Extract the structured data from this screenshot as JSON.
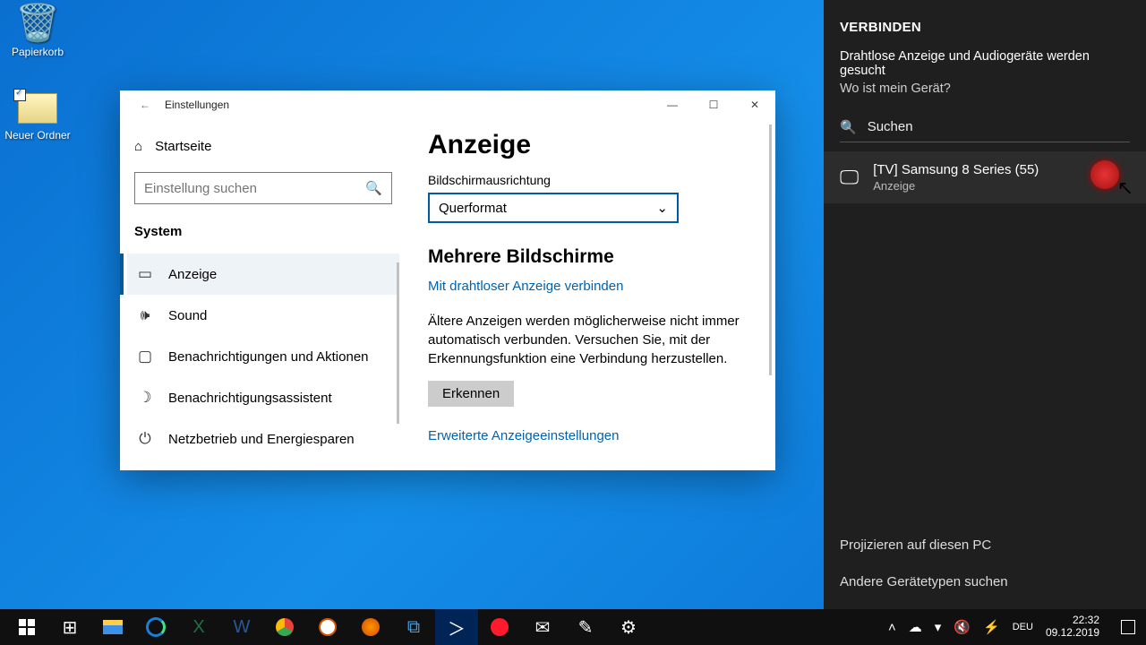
{
  "desktop": {
    "recycle_bin": "Papierkorb",
    "new_folder": "Neuer Ordner"
  },
  "window": {
    "title": "Einstellungen",
    "home": "Startseite",
    "search_placeholder": "Einstellung suchen",
    "category": "System",
    "nav": [
      {
        "icon": "display-icon",
        "glyph": "▭",
        "label": "Anzeige",
        "active": true
      },
      {
        "icon": "speaker-icon",
        "glyph": "🔊",
        "label": "Sound"
      },
      {
        "icon": "bell-icon",
        "glyph": "▢",
        "label": "Benachrichtigungen und Aktionen"
      },
      {
        "icon": "moon-icon",
        "glyph": "☽",
        "label": "Benachrichtigungsassistent"
      },
      {
        "icon": "power-icon",
        "glyph": "⏻",
        "label": "Netzbetrieb und Energiesparen"
      }
    ],
    "content": {
      "page_title": "Anzeige",
      "orientation_label": "Bildschirmausrichtung",
      "orientation_value": "Querformat",
      "multi_title": "Mehrere Bildschirme",
      "connect_link": "Mit drahtloser Anzeige verbinden",
      "desc": "Ältere Anzeigen werden möglicherweise nicht immer automatisch verbunden. Versuchen Sie, mit der Erkennungsfunktion eine Verbindung herzustellen.",
      "detect": "Erkennen",
      "advanced_link": "Erweiterte Anzeigeeinstellungen"
    }
  },
  "connect": {
    "title": "VERBINDEN",
    "status": "Drahtlose Anzeige und Audiogeräte werden gesucht",
    "where": "Wo ist mein Gerät?",
    "search": "Suchen",
    "device": {
      "name": "[TV] Samsung 8 Series (55)",
      "type": "Anzeige"
    },
    "project": "Projizieren auf diesen PC",
    "other": "Andere Gerätetypen suchen"
  },
  "taskbar": {
    "time": "22:32",
    "date": "09.12.2019"
  }
}
